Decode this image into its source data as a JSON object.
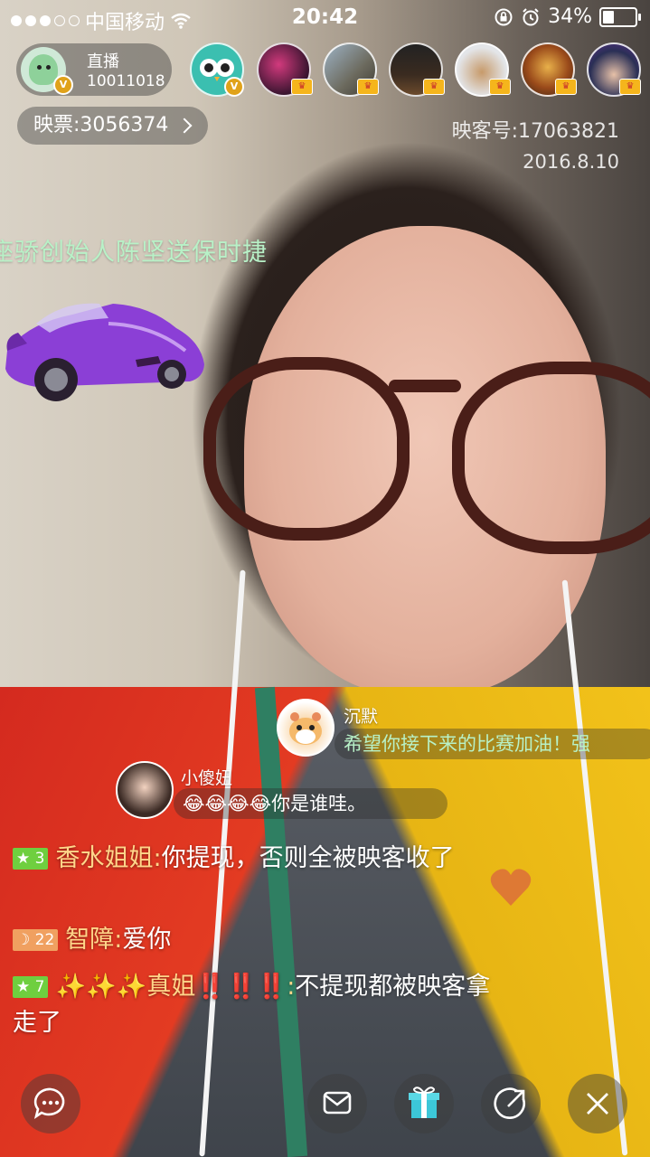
{
  "status_bar": {
    "carrier": "中国移动",
    "time": "20:42",
    "battery": "34%",
    "battery_level": 0.34
  },
  "host": {
    "label": "直播",
    "id": "10011018"
  },
  "viewers": [
    {
      "name": "owl-avatar"
    },
    {
      "name": "concert-avatar"
    },
    {
      "name": "cliff-avatar"
    },
    {
      "name": "machine-avatar"
    },
    {
      "name": "figure-avatar"
    },
    {
      "name": "monkey-king-avatar"
    },
    {
      "name": "boy-avatar"
    }
  ],
  "tickets": {
    "label": "映票:3056374"
  },
  "account": {
    "id_label": "映客号:17063821",
    "date": "2016.8.10"
  },
  "gift_announcement": {
    "text": "座骄创始人陈坚送保时捷"
  },
  "floating_comments": [
    {
      "user": "沉默",
      "text": "希望你接下来的比赛加油！强"
    },
    {
      "user": "小傻妞",
      "text": "😂😂😂😂你是谁哇。"
    }
  ],
  "chat": [
    {
      "level": "3",
      "level_icon": "star",
      "user": "香水姐姐:",
      "text": "你提现，否则全被映客收了"
    },
    {
      "level": "22",
      "level_icon": "moon",
      "user": "智障:",
      "text": "爱你"
    },
    {
      "level": "7",
      "level_icon": "star",
      "user": "✨✨✨真姐‼️‼️‼️:",
      "text": "不提现都被映客拿走了"
    }
  ],
  "colors": {
    "level_green": "#6fcf3f",
    "level_orange": "#f0a060",
    "banner_green": "#b8f1c7"
  },
  "bottom_bar": {
    "buttons": [
      "chat-icon",
      "mail-icon",
      "gift-icon",
      "share-icon",
      "close-icon"
    ]
  }
}
